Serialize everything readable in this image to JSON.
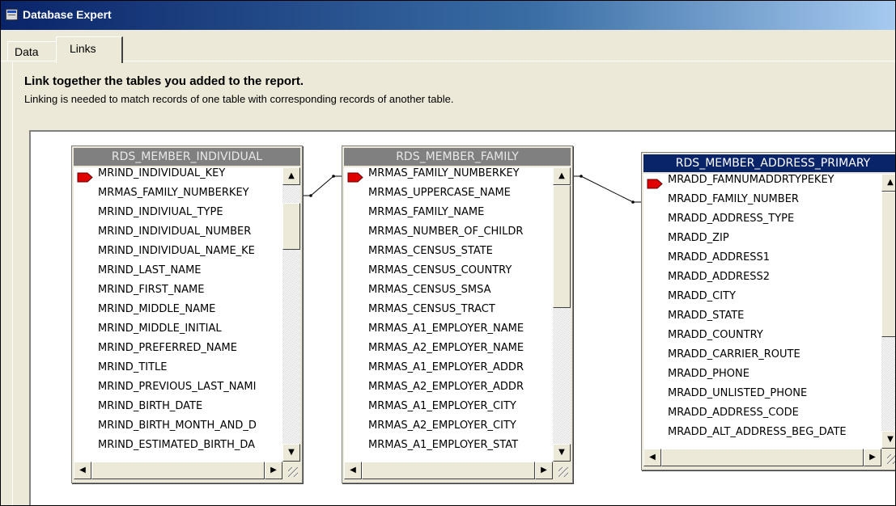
{
  "window": {
    "title": "Database Expert"
  },
  "tabs": [
    {
      "label": "Data"
    },
    {
      "label": "Links"
    }
  ],
  "links_tab": {
    "heading": "Link together the tables you added to the report.",
    "subtitle": "Linking is needed to match records of one table with corresponding records of another table."
  },
  "tables": [
    {
      "name": "RDS_MEMBER_INDIVIDUAL",
      "active": false,
      "fields": [
        {
          "label": "MRIND_INDIVIDUAL_KEY",
          "key": true
        },
        {
          "label": "MRMAS_FAMILY_NUMBERKEY",
          "key": false
        },
        {
          "label": "MRIND_INDIVIUAL_TYPE",
          "key": false
        },
        {
          "label": "MRIND_INDIVIDUAL_NUMBER",
          "key": false
        },
        {
          "label": "MRIND_INDIVIDUAL_NAME_KE",
          "key": false
        },
        {
          "label": "MRIND_LAST_NAME",
          "key": false
        },
        {
          "label": "MRIND_FIRST_NAME",
          "key": false
        },
        {
          "label": "MRIND_MIDDLE_NAME",
          "key": false
        },
        {
          "label": "MRIND_MIDDLE_INITIAL",
          "key": false
        },
        {
          "label": "MRIND_PREFERRED_NAME",
          "key": false
        },
        {
          "label": "MRIND_TITLE",
          "key": false
        },
        {
          "label": "MRIND_PREVIOUS_LAST_NAMI",
          "key": false
        },
        {
          "label": "MRIND_BIRTH_DATE",
          "key": false
        },
        {
          "label": "MRIND_BIRTH_MONTH_AND_D",
          "key": false
        },
        {
          "label": "MRIND_ESTIMATED_BIRTH_DA",
          "key": false
        }
      ]
    },
    {
      "name": "RDS_MEMBER_FAMILY",
      "active": false,
      "fields": [
        {
          "label": "MRMAS_FAMILY_NUMBERKEY",
          "key": true
        },
        {
          "label": "MRMAS_UPPERCASE_NAME",
          "key": false
        },
        {
          "label": "MRMAS_FAMILY_NAME",
          "key": false
        },
        {
          "label": "MRMAS_NUMBER_OF_CHILDR",
          "key": false
        },
        {
          "label": "MRMAS_CENSUS_STATE",
          "key": false
        },
        {
          "label": "MRMAS_CENSUS_COUNTRY",
          "key": false
        },
        {
          "label": "MRMAS_CENSUS_SMSA",
          "key": false
        },
        {
          "label": "MRMAS_CENSUS_TRACT",
          "key": false
        },
        {
          "label": "MRMAS_A1_EMPLOYER_NAME",
          "key": false
        },
        {
          "label": "MRMAS_A2_EMPLOYER_NAME",
          "key": false
        },
        {
          "label": "MRMAS_A1_EMPLOYER_ADDR",
          "key": false
        },
        {
          "label": "MRMAS_A2_EMPLOYER_ADDR",
          "key": false
        },
        {
          "label": "MRMAS_A1_EMPLOYER_CITY",
          "key": false
        },
        {
          "label": "MRMAS_A2_EMPLOYER_CITY",
          "key": false
        },
        {
          "label": "MRMAS_A1_EMPLOYER_STAT",
          "key": false
        }
      ]
    },
    {
      "name": "RDS_MEMBER_ADDRESS_PRIMARY",
      "active": true,
      "fields": [
        {
          "label": "MRADD_FAMNUMADDRTYPEKEY",
          "key": true
        },
        {
          "label": "MRADD_FAMILY_NUMBER",
          "key": false
        },
        {
          "label": "MRADD_ADDRESS_TYPE",
          "key": false
        },
        {
          "label": "MRADD_ZIP",
          "key": false
        },
        {
          "label": "MRADD_ADDRESS1",
          "key": false
        },
        {
          "label": "MRADD_ADDRESS2",
          "key": false
        },
        {
          "label": "MRADD_CITY",
          "key": false
        },
        {
          "label": "MRADD_STATE",
          "key": false
        },
        {
          "label": "MRADD_COUNTRY",
          "key": false
        },
        {
          "label": "MRADD_CARRIER_ROUTE",
          "key": false
        },
        {
          "label": "MRADD_PHONE",
          "key": false
        },
        {
          "label": "MRADD_UNLISTED_PHONE",
          "key": false
        },
        {
          "label": "MRADD_ADDRESS_CODE",
          "key": false
        },
        {
          "label": "MRADD_ALT_ADDRESS_BEG_DATE",
          "key": false
        }
      ]
    }
  ],
  "links": [
    {
      "from": "RDS_MEMBER_INDIVIDUAL.MRMAS_FAMILY_NUMBERKEY",
      "to": "RDS_MEMBER_FAMILY.MRMAS_FAMILY_NUMBERKEY"
    },
    {
      "from": "RDS_MEMBER_FAMILY.MRMAS_FAMILY_NUMBERKEY",
      "to": "RDS_MEMBER_ADDRESS_PRIMARY.MRADD_FAMILY_NUMBER"
    }
  ],
  "colors": {
    "key_icon": "#e00000",
    "active_title": "#0a246a",
    "inactive_title": "#808080",
    "link_line": "#000000"
  }
}
